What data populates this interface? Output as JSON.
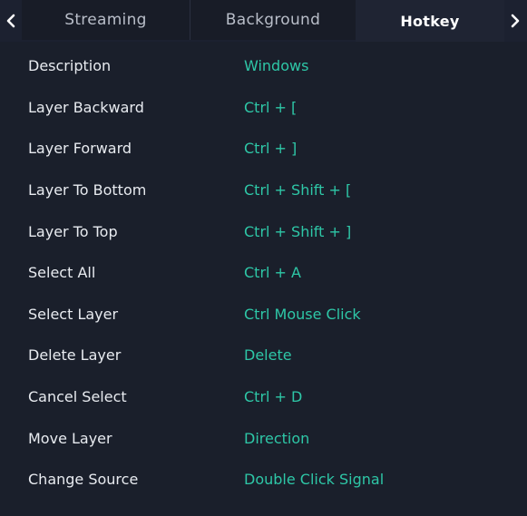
{
  "tabs": {
    "streaming": "Streaming",
    "background": "Background",
    "hotkey": "Hotkey",
    "active": "Hotkey"
  },
  "colors": {
    "background": "#1a1f2b",
    "label": "#e8ebf0",
    "value": "#2ec7a7",
    "tab_inactive": "#b9bec9",
    "tab_active": "#ffffff"
  },
  "hotkeys": [
    {
      "label": "Description",
      "value": "Windows"
    },
    {
      "label": "Layer Backward",
      "value": "Ctrl + ["
    },
    {
      "label": "Layer Forward",
      "value": "Ctrl + ]"
    },
    {
      "label": "Layer To Bottom",
      "value": "Ctrl + Shift + ["
    },
    {
      "label": "Layer To Top",
      "value": "Ctrl + Shift + ]"
    },
    {
      "label": "Select All",
      "value": "Ctrl + A"
    },
    {
      "label": "Select Layer",
      "value": "Ctrl Mouse Click"
    },
    {
      "label": "Delete Layer",
      "value": "Delete"
    },
    {
      "label": "Cancel Select",
      "value": "Ctrl + D"
    },
    {
      "label": "Move Layer",
      "value": "Direction"
    },
    {
      "label": "Change Source",
      "value": "Double Click Signal"
    }
  ]
}
